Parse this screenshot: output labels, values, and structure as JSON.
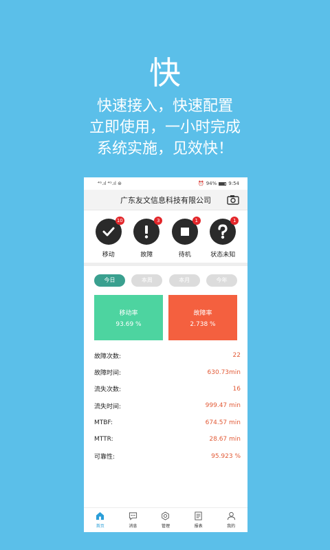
{
  "hero": {
    "title": "快",
    "lines": [
      "快速接入，快速配置",
      "立即使用，一小时完成",
      "系统实施，见效快！"
    ]
  },
  "status_bar": {
    "left": "⁴ᴳ.ıl ⁴ᴳ.ıl ⊛",
    "alarm": "⏰",
    "battery_pct": "94%",
    "time": "9:54"
  },
  "header": {
    "title": "广东友文信息科技有限公司",
    "camera_icon": "camera-icon"
  },
  "status_tiles": [
    {
      "label": "移动",
      "badge": "10",
      "icon": "check-icon"
    },
    {
      "label": "故障",
      "badge": "3",
      "icon": "exclamation-icon"
    },
    {
      "label": "待机",
      "badge": "1",
      "icon": "stop-icon"
    },
    {
      "label": "状态未知",
      "badge": "1",
      "icon": "question-icon"
    }
  ],
  "period_tabs": [
    {
      "label": "今日",
      "active": true
    },
    {
      "label": "本周",
      "active": false
    },
    {
      "label": "本月",
      "active": false
    },
    {
      "label": "今年",
      "active": false
    }
  ],
  "kpis": [
    {
      "label": "移动率",
      "value": "93.69 %",
      "color": "#4dd4a0"
    },
    {
      "label": "故障率",
      "value": "2.738 %",
      "color": "#f4603f"
    }
  ],
  "stats": [
    {
      "label": "故障次数:",
      "value": "22"
    },
    {
      "label": "故障时间:",
      "value": "630.73min"
    },
    {
      "label": "流失次数:",
      "value": "16"
    },
    {
      "label": "流失时间:",
      "value": "999.47 min"
    },
    {
      "label": "MTBF:",
      "value": "674.57 min"
    },
    {
      "label": "MTTR:",
      "value": "28.67 min"
    },
    {
      "label": "可靠性:",
      "value": "95.923 %"
    }
  ],
  "tabbar": [
    {
      "label": "首页",
      "icon": "home-icon",
      "active": true
    },
    {
      "label": "消息",
      "icon": "message-icon",
      "active": false
    },
    {
      "label": "管理",
      "icon": "gear-icon",
      "active": false
    },
    {
      "label": "报表",
      "icon": "report-icon",
      "active": false
    },
    {
      "label": "我的",
      "icon": "user-icon",
      "active": false
    }
  ],
  "colors": {
    "background": "#5bbfe9",
    "accent_green": "#3aa08f",
    "kpi_green": "#4dd4a0",
    "kpi_red": "#f4603f",
    "value_red": "#e25a36",
    "badge_red": "#e3262a",
    "tab_active": "#2a9ed8"
  }
}
